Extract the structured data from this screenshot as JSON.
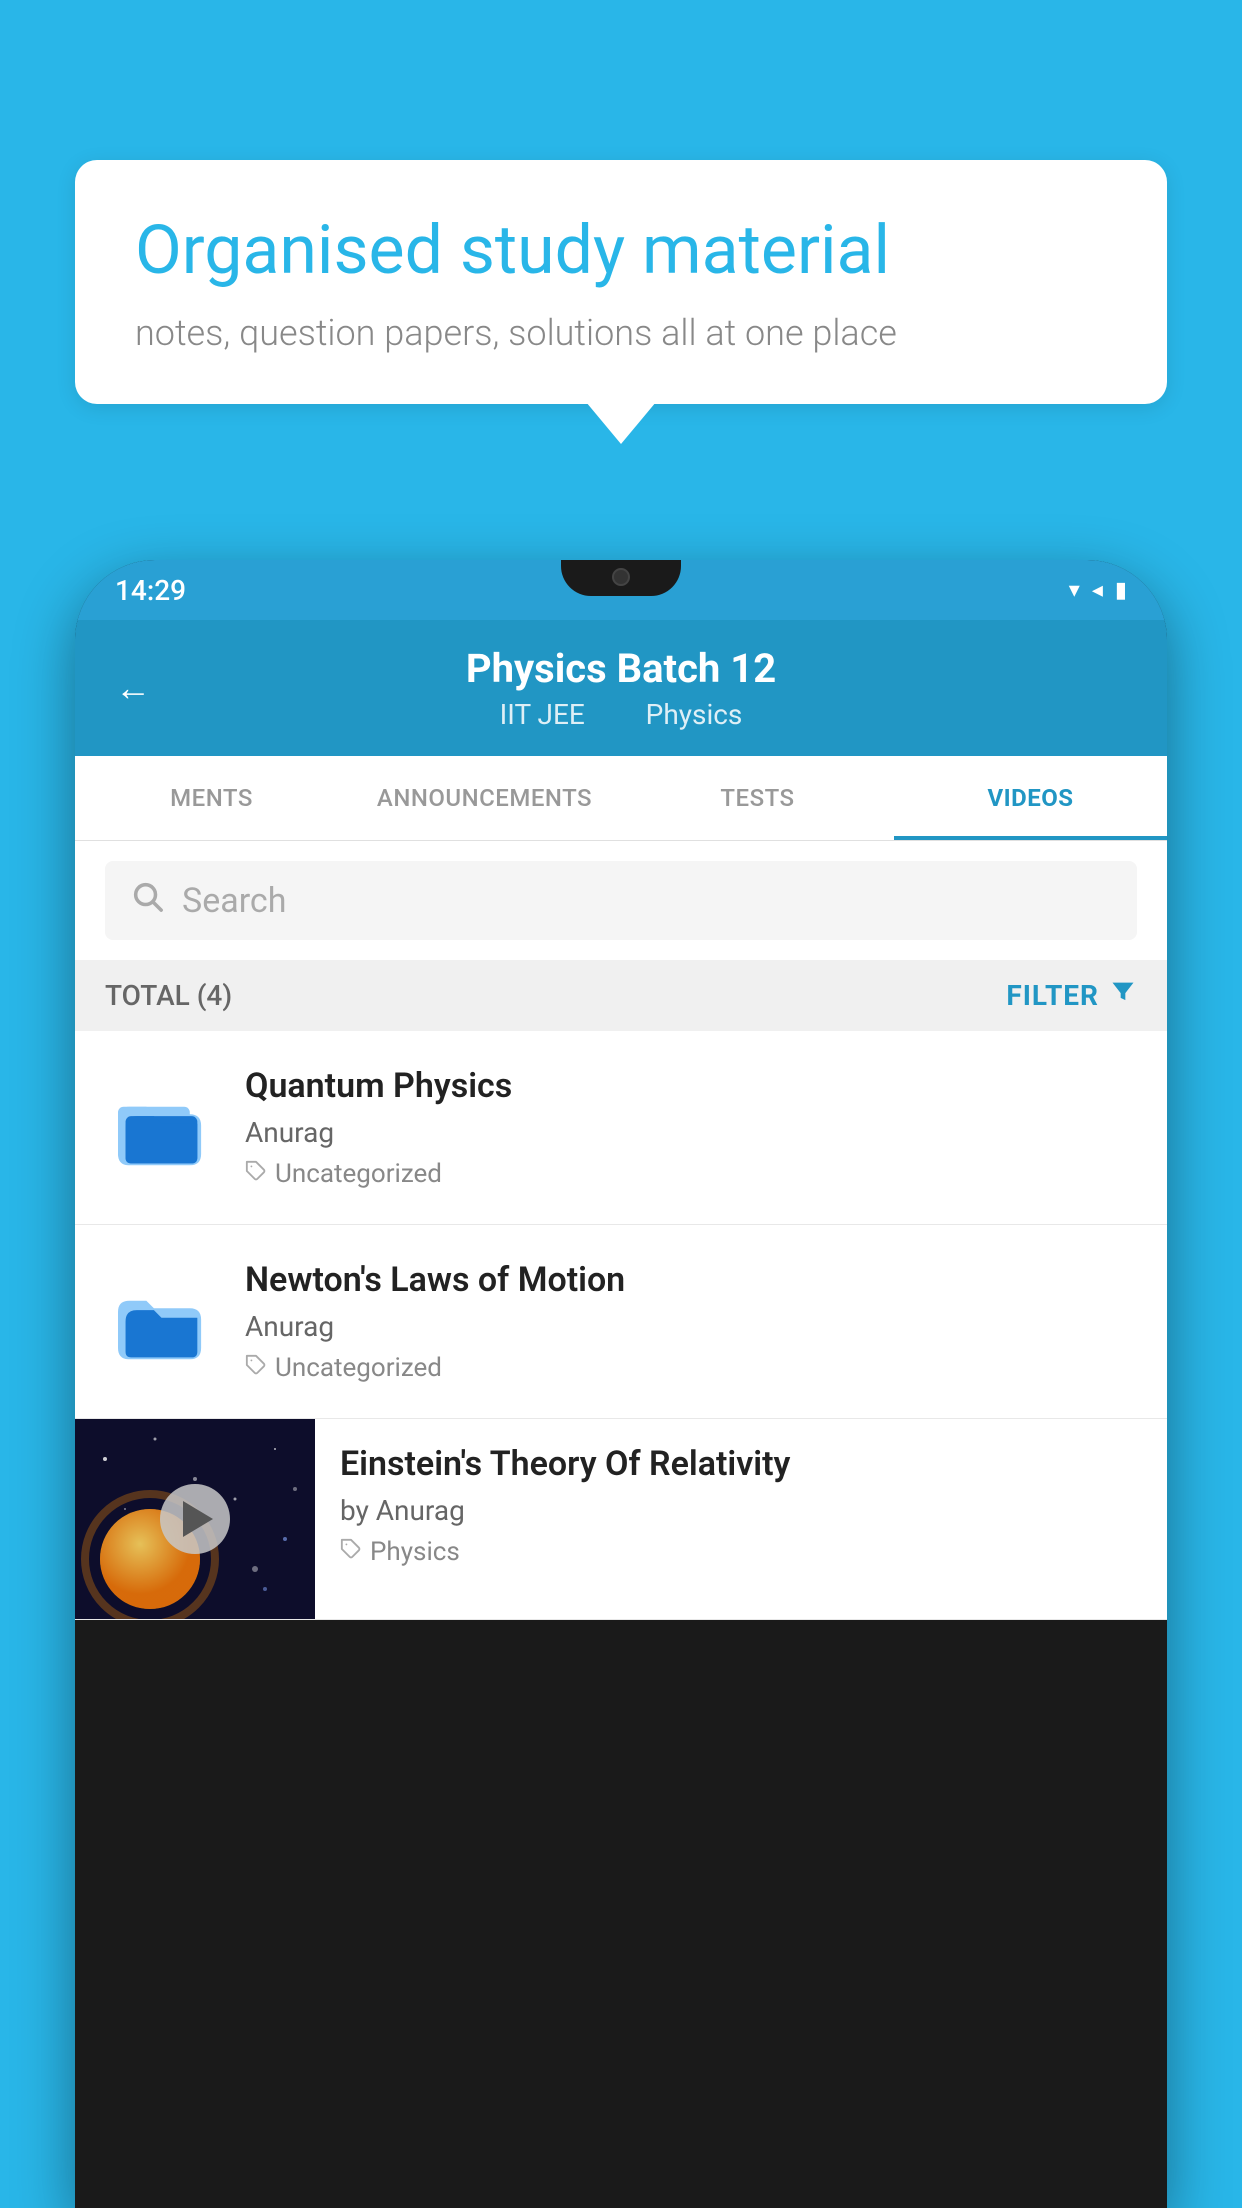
{
  "background_color": "#29b6e8",
  "bubble": {
    "title": "Organised study material",
    "subtitle": "notes, question papers, solutions all at one place"
  },
  "status_bar": {
    "time": "14:29",
    "wifi_icon": "▼",
    "signal_icon": "◀",
    "battery_icon": "▮"
  },
  "header": {
    "back_label": "←",
    "title": "Physics Batch 12",
    "subtitle_1": "IIT JEE",
    "subtitle_2": "Physics"
  },
  "tabs": [
    {
      "label": "MENTS",
      "active": false
    },
    {
      "label": "ANNOUNCEMENTS",
      "active": false
    },
    {
      "label": "TESTS",
      "active": false
    },
    {
      "label": "VIDEOS",
      "active": true
    }
  ],
  "search": {
    "placeholder": "Search"
  },
  "filter_bar": {
    "total": "TOTAL (4)",
    "filter_label": "FILTER"
  },
  "videos": [
    {
      "title": "Quantum Physics",
      "author": "Anurag",
      "tag": "Uncategorized",
      "type": "folder"
    },
    {
      "title": "Newton's Laws of Motion",
      "author": "Anurag",
      "tag": "Uncategorized",
      "type": "folder"
    },
    {
      "title": "Einstein's Theory Of Relativity",
      "author": "by Anurag",
      "tag": "Physics",
      "type": "video"
    }
  ]
}
